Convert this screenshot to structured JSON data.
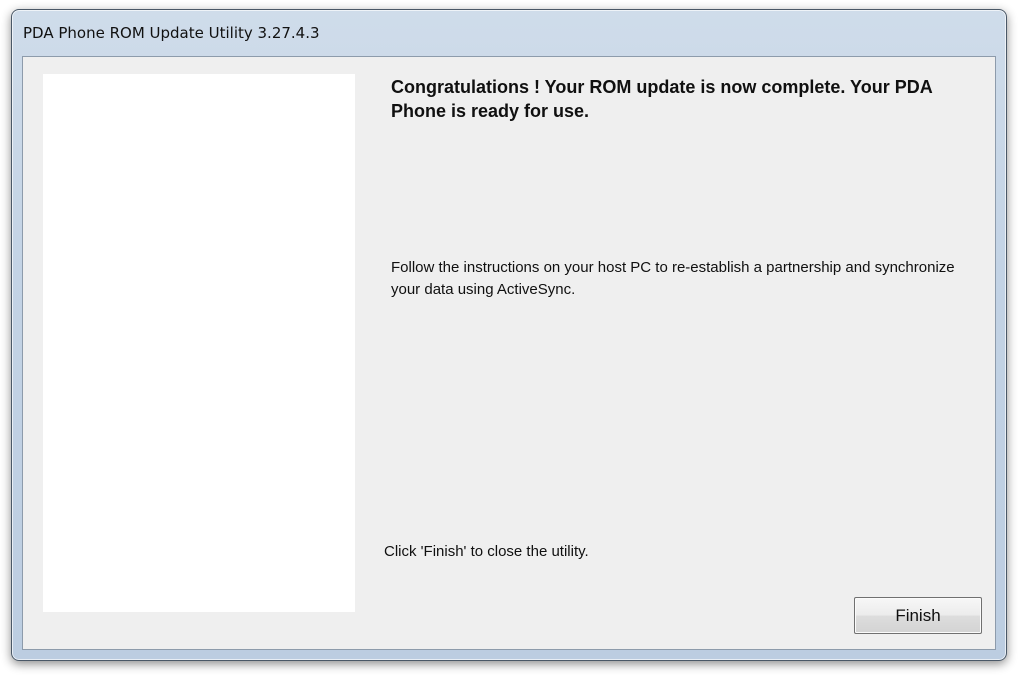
{
  "window": {
    "title": "PDA Phone ROM Update Utility 3.27.4.3"
  },
  "main": {
    "heading": "Congratulations ! Your ROM update is now complete. Your PDA Phone is ready for use.",
    "instructions": "Follow the instructions on your host PC to re-establish a partnership and synchronize your data using ActiveSync.",
    "close_hint": "Click 'Finish' to close the utility."
  },
  "buttons": {
    "finish_label": "Finish"
  }
}
